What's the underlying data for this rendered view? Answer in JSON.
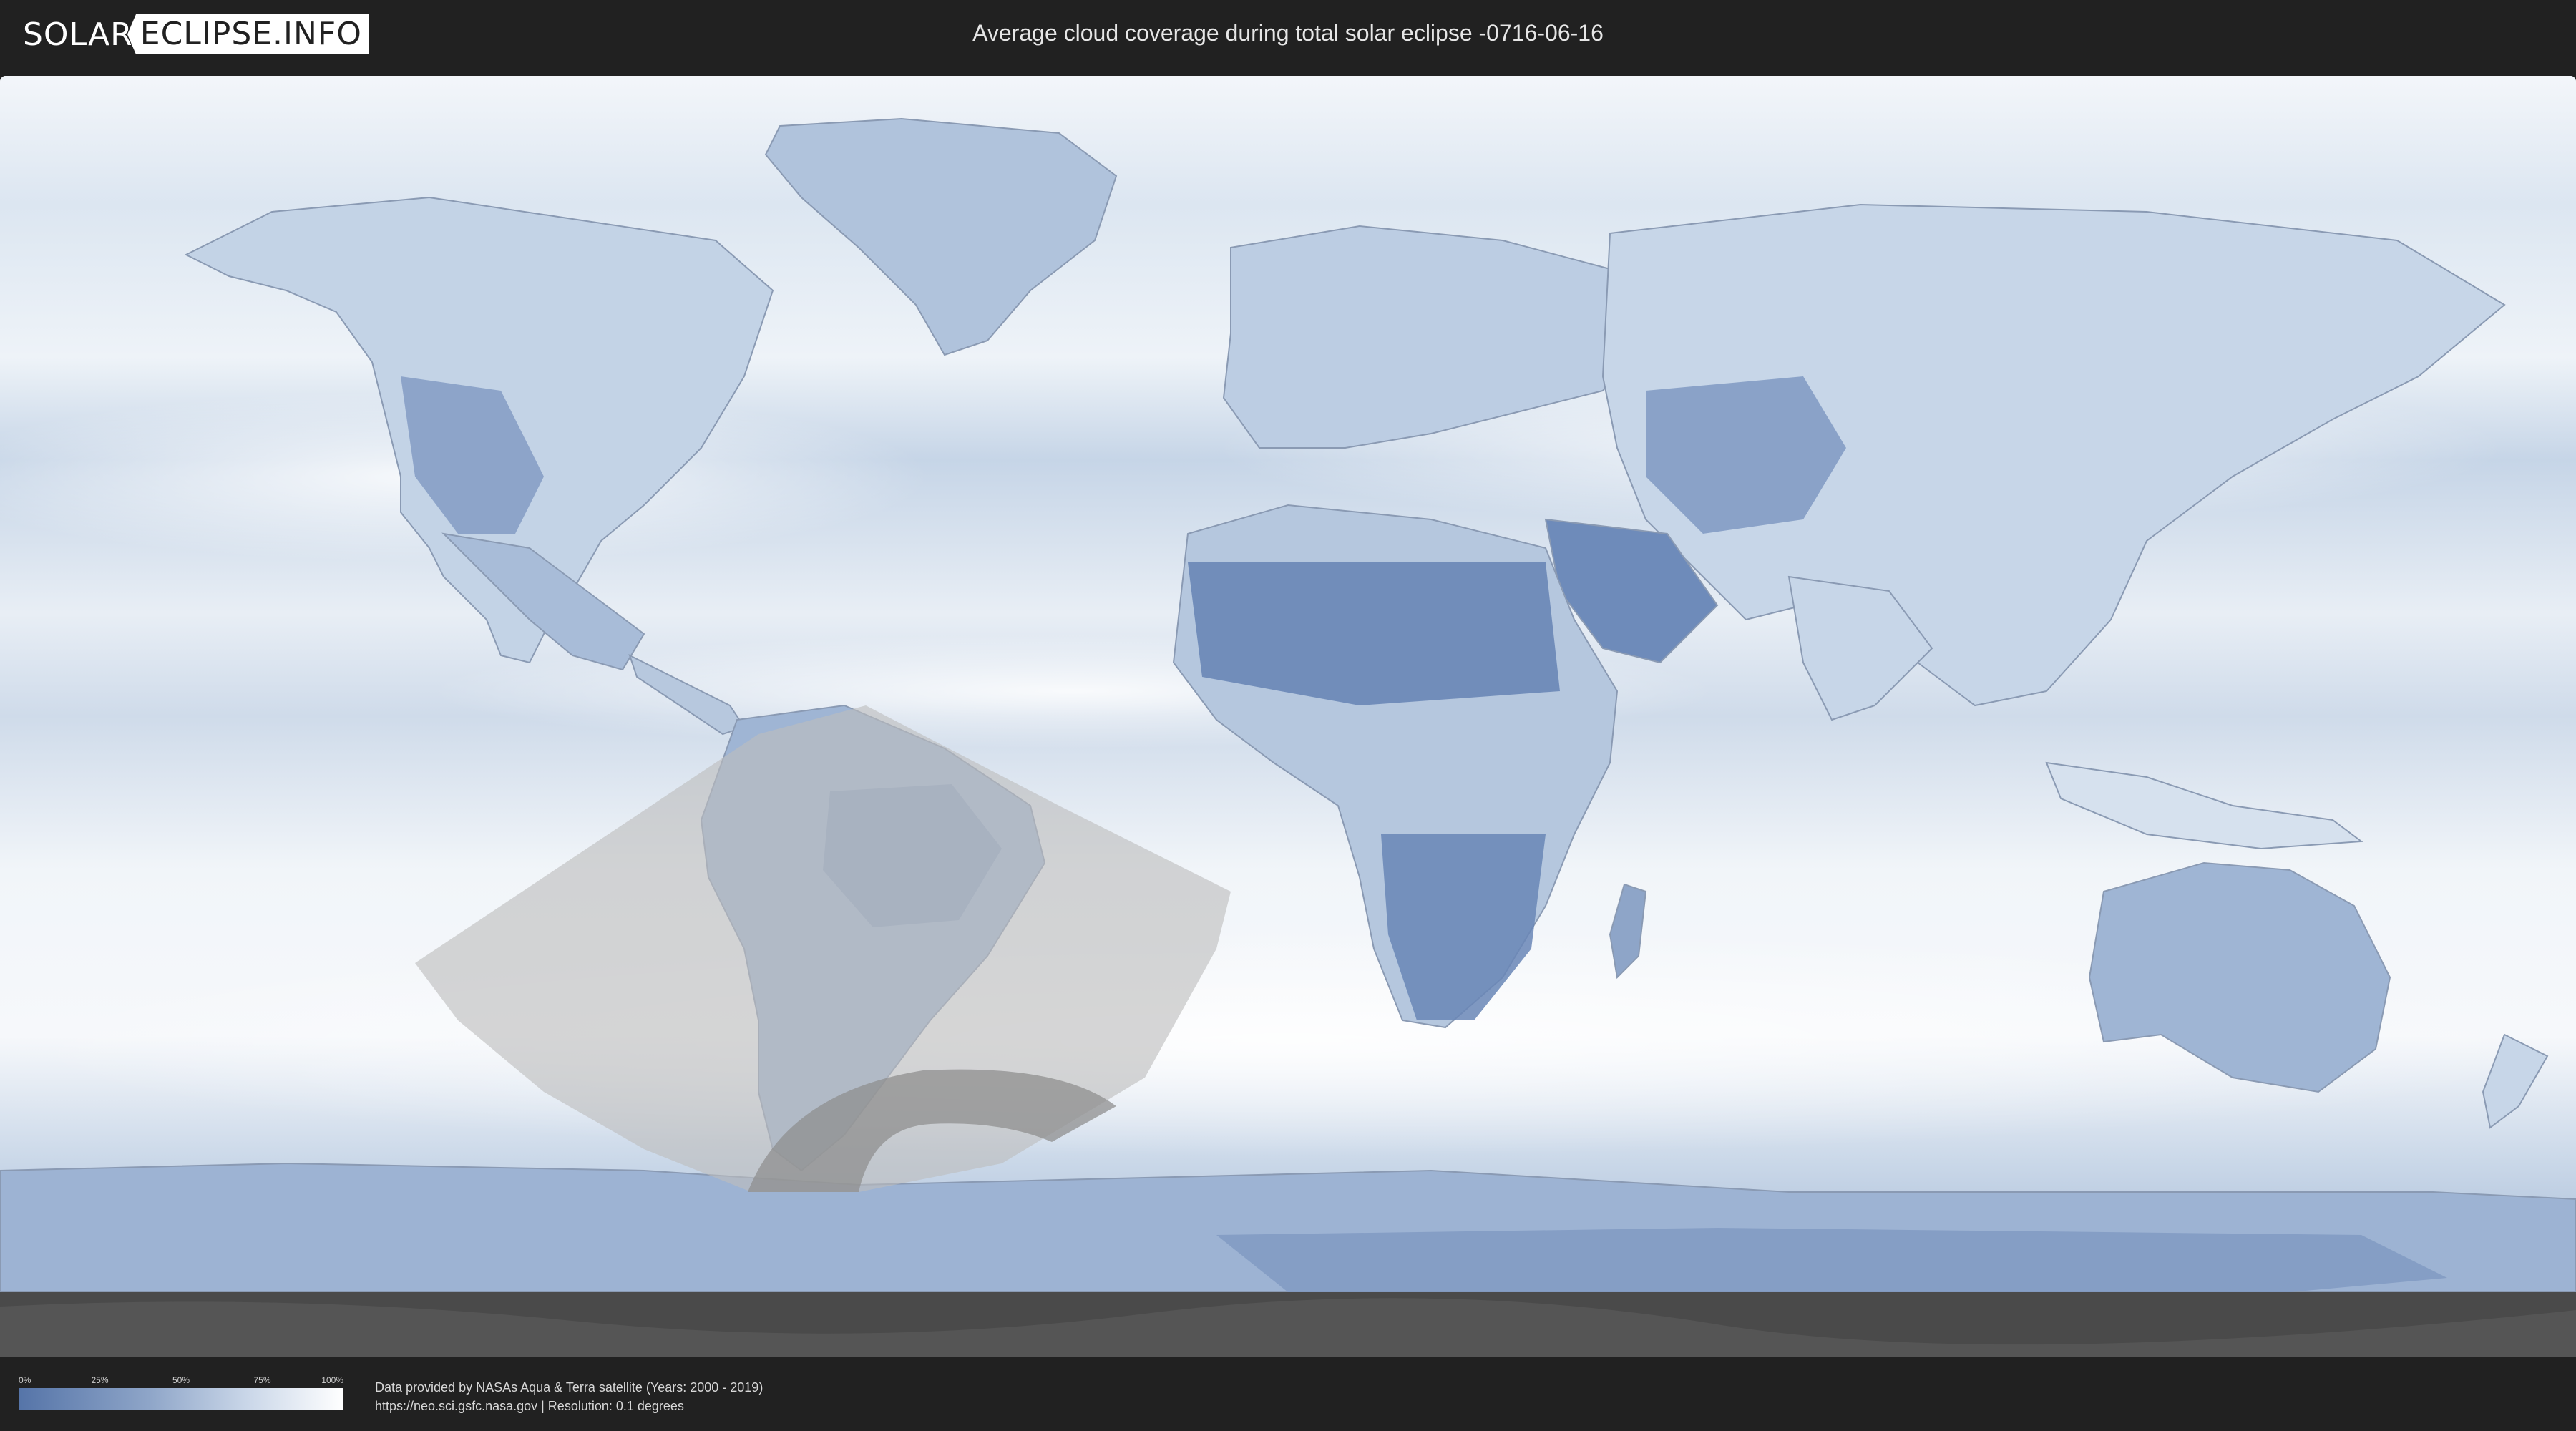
{
  "header": {
    "logo_left": "SOLAR",
    "logo_right": "ECLIPSE.INFO",
    "title": "Average cloud coverage during total solar eclipse -0716-06-16"
  },
  "map": {
    "colors": {
      "clear_sky": "#5574a8",
      "cloudy": "#ffffff",
      "eclipse_overlay": "#bdbdbd",
      "antarctic_shadow": "#3f3f3f"
    }
  },
  "legend": {
    "ticks": [
      "0%",
      "25%",
      "50%",
      "75%",
      "100%"
    ]
  },
  "footer": {
    "credit_line1": "Data provided by NASAs Aqua & Terra satellite (Years: 2000 - 2019)",
    "credit_line2": "https://neo.sci.gsfc.nasa.gov | Resolution: 0.1 degrees"
  }
}
